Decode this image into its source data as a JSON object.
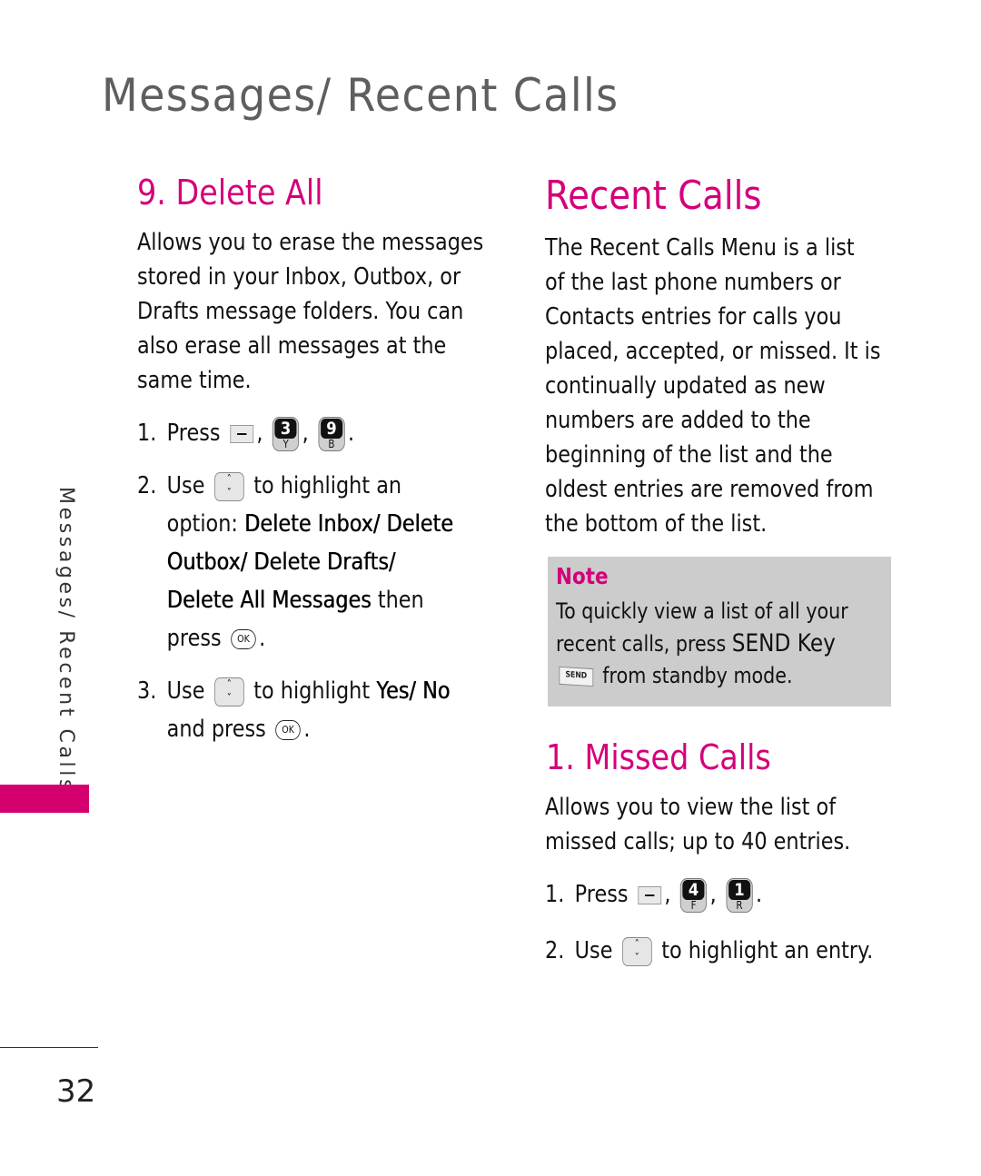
{
  "header": {
    "title": "Messages/ Recent Calls"
  },
  "sidebar": {
    "section_label": "Messages/ Recent Calls",
    "accent_color": "#d4006e"
  },
  "footer": {
    "page_number": "32"
  },
  "left_column": {
    "heading": "9. Delete All",
    "description_lines": [
      "Allows you to erase the messages",
      "stored in your Inbox, Outbox, or",
      "Drafts message folders. You can",
      "also erase all messages at the",
      "same time."
    ],
    "steps": [
      {
        "num": "1.",
        "text": "Press",
        "keys": [
          {
            "type": "softkey-icon"
          },
          {
            "type": "number-key-icon",
            "digit": "3",
            "letter": "Y"
          },
          {
            "type": "number-key-icon",
            "digit": "9",
            "letter": "B"
          }
        ]
      },
      {
        "num": "2.",
        "use": "Use",
        "after_icon": "to highlight an",
        "line2_prefix": "option: ",
        "line2_bold": "Delete Inbox/ Delete",
        "line3_bold": "Outbox/ Delete Drafts/",
        "line4_bold": "Delete All Messages",
        "line4_rest": " then",
        "line5": "press",
        "ok_label": "OK"
      },
      {
        "num": "3.",
        "use": "Use",
        "after_icon": "to highlight ",
        "bold": "Yes/ No",
        "line2": "and press",
        "ok_label": "OK"
      }
    ]
  },
  "right_column": {
    "heading": "Recent Calls",
    "description_lines": [
      "The Recent Calls Menu is a list",
      "of the last phone numbers or",
      "Contacts entries for calls you",
      "placed, accepted, or missed. It is",
      "continually updated as new",
      "numbers are added to the",
      "beginning of the list and the",
      "oldest entries are removed from",
      "the bottom of the list."
    ],
    "note": {
      "title": "Note",
      "line1": "To quickly view a list of all your",
      "line2_prefix": "recent calls, press ",
      "line2_key": "SEND Key",
      "send_key_label": "SEND",
      "line3": "from standby mode."
    },
    "subsection": {
      "heading": "1. Missed Calls",
      "description_lines": [
        "Allows you to view the list of",
        "missed calls; up to 40 entries."
      ],
      "steps": [
        {
          "num": "1.",
          "text": "Press",
          "keys": [
            {
              "type": "softkey-icon"
            },
            {
              "type": "number-key-icon",
              "digit": "4",
              "letter": "F"
            },
            {
              "type": "number-key-icon",
              "digit": "1",
              "letter": "R"
            }
          ]
        },
        {
          "num": "2.",
          "use": "Use",
          "after_icon": "to highlight an entry."
        }
      ]
    }
  }
}
